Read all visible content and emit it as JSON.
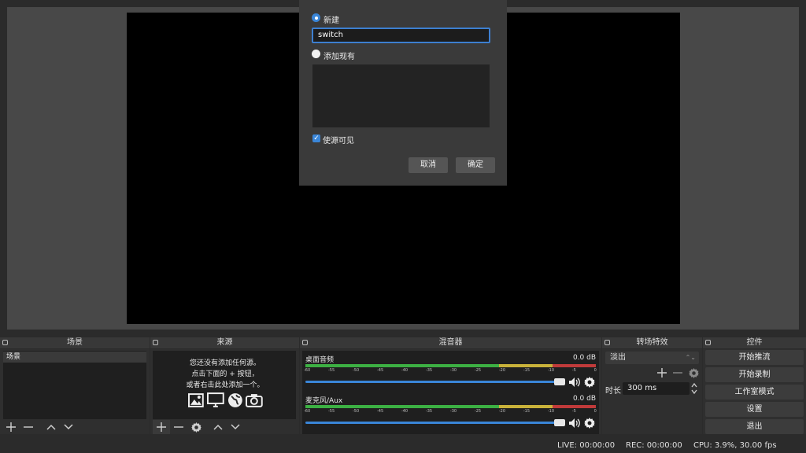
{
  "docks": {
    "scenes": {
      "title": "场景",
      "items": [
        "场景"
      ]
    },
    "sources": {
      "title": "来源",
      "hint_lines": [
        "您还没有添加任何源。",
        "点击下面的 + 按钮，",
        "或者右击此处添加一个。"
      ]
    },
    "mixer": {
      "title": "混音器",
      "channels": [
        {
          "name": "桌面音频",
          "db": "0.0 dB"
        },
        {
          "name": "麦克风/Aux",
          "db": "0.0 dB"
        }
      ],
      "scale": [
        "-60",
        "-55",
        "-50",
        "-45",
        "-40",
        "-35",
        "-30",
        "-25",
        "-20",
        "-15",
        "-10",
        "-5",
        "0"
      ]
    },
    "transitions": {
      "title": "转场特效",
      "selected": "淡出",
      "duration_label": "时长",
      "duration_value": "300 ms"
    },
    "controls": {
      "title": "控件",
      "buttons": [
        "开始推流",
        "开始录制",
        "工作室模式",
        "设置",
        "退出"
      ]
    }
  },
  "status": {
    "live": "LIVE: 00:00:00",
    "rec": "REC: 00:00:00",
    "cpu": "CPU: 3.9%, 30.00 fps"
  },
  "dialog": {
    "option_new": "新建",
    "name_value": "switch",
    "option_existing": "添加现有",
    "visible_label": "使源可见",
    "visible_checked": true,
    "cancel": "取消",
    "ok": "确定"
  },
  "colors": {
    "accent": "#3a86d8",
    "meter_green": "#3cb043",
    "meter_yellow": "#c9b23a",
    "meter_red": "#c03a3a"
  },
  "icons": [
    "plus-icon",
    "minus-icon",
    "gear-icon",
    "arrow-up-icon",
    "arrow-down-icon",
    "image-icon",
    "monitor-icon",
    "globe-icon",
    "camera-icon",
    "speaker-icon",
    "float-icon"
  ]
}
